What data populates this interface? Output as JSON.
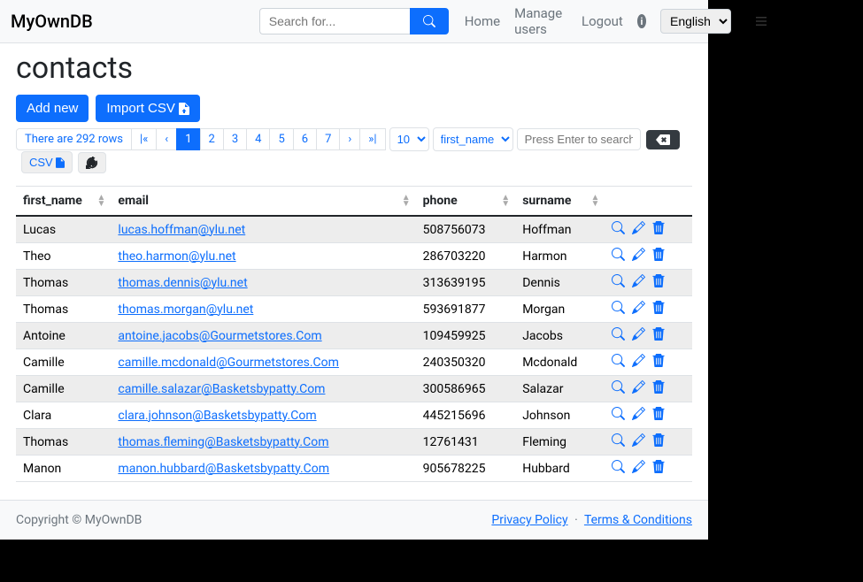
{
  "header": {
    "brand": "MyOwnDB",
    "search_placeholder": "Search for...",
    "nav": {
      "home": "Home",
      "manage_users": "Manage users",
      "logout": "Logout"
    },
    "language": "English"
  },
  "page": {
    "title": "contacts"
  },
  "buttons": {
    "add_new": "Add new",
    "import_csv": "Import CSV"
  },
  "pagination": {
    "info": "There are 292 rows",
    "first": "|«",
    "prev": "‹",
    "pages": [
      "1",
      "2",
      "3",
      "4",
      "5",
      "6",
      "7"
    ],
    "next": "›",
    "last": "»|",
    "page_size": "10",
    "sort_field": "first_name",
    "search_placeholder": "Press Enter to search",
    "csv": "CSV"
  },
  "table": {
    "columns": {
      "first_name": "first_name",
      "email": "email",
      "phone": "phone",
      "surname": "surname"
    },
    "rows": [
      {
        "first_name": "Lucas",
        "email": "lucas.hoffman@ylu.net",
        "phone": "508756073",
        "surname": "Hoffman"
      },
      {
        "first_name": "Theo",
        "email": "theo.harmon@ylu.net",
        "phone": "286703220",
        "surname": "Harmon"
      },
      {
        "first_name": "Thomas",
        "email": "thomas.dennis@ylu.net",
        "phone": "313639195",
        "surname": "Dennis"
      },
      {
        "first_name": "Thomas",
        "email": "thomas.morgan@ylu.net",
        "phone": "593691877",
        "surname": "Morgan"
      },
      {
        "first_name": "Antoine",
        "email": "antoine.jacobs@Gourmetstores.Com",
        "phone": "109459925",
        "surname": "Jacobs"
      },
      {
        "first_name": "Camille",
        "email": "camille.mcdonald@Gourmetstores.Com",
        "phone": "240350320",
        "surname": "Mcdonald"
      },
      {
        "first_name": "Camille",
        "email": "camille.salazar@Basketsbypatty.Com",
        "phone": "300586965",
        "surname": "Salazar"
      },
      {
        "first_name": "Clara",
        "email": "clara.johnson@Basketsbypatty.Com",
        "phone": "445215696",
        "surname": "Johnson"
      },
      {
        "first_name": "Thomas",
        "email": "thomas.fleming@Basketsbypatty.Com",
        "phone": "12761431",
        "surname": "Fleming"
      },
      {
        "first_name": "Manon",
        "email": "manon.hubbard@Basketsbypatty.Com",
        "phone": "905678225",
        "surname": "Hubbard"
      }
    ]
  },
  "footer": {
    "copyright": "Copyright © MyOwnDB",
    "privacy": "Privacy Policy",
    "terms": "Terms & Conditions"
  }
}
